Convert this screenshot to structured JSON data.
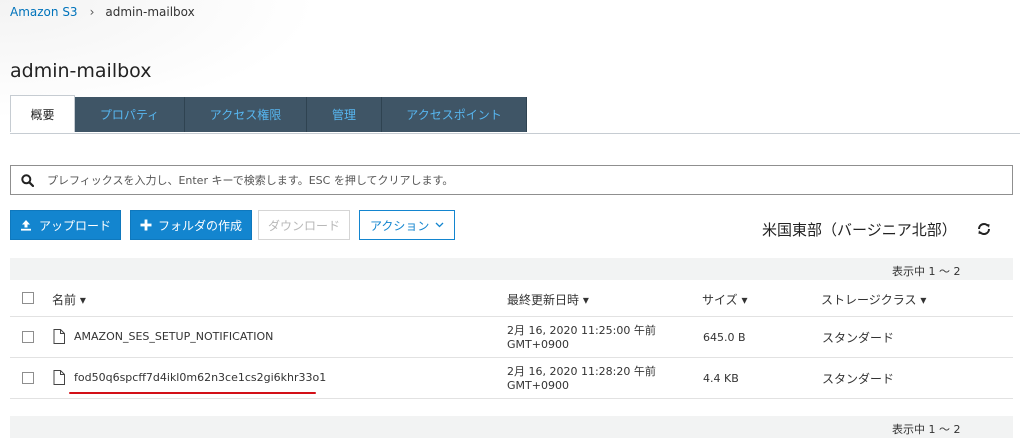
{
  "breadcrumb": {
    "root": "Amazon S3",
    "separator": "›",
    "current": "admin-mailbox"
  },
  "bucket_title": "admin-mailbox",
  "tabs": [
    {
      "label": "概要",
      "active": true
    },
    {
      "label": "プロパティ",
      "active": false
    },
    {
      "label": "アクセス権限",
      "active": false
    },
    {
      "label": "管理",
      "active": false
    },
    {
      "label": "アクセスポイント",
      "active": false
    }
  ],
  "search": {
    "placeholder": "プレフィックスを入力し、Enter キーで検索します。ESC を押してクリアします。"
  },
  "toolbar": {
    "upload": "アップロード",
    "create_folder": "フォルダの作成",
    "download": "ダウンロード",
    "actions": "アクション"
  },
  "region": "米国東部（バージニア北部）",
  "pagination": {
    "top": "表示中 1 ～ 2",
    "bottom": "表示中 1 ～ 2"
  },
  "table": {
    "columns": {
      "name": "名前",
      "modified": "最終更新日時",
      "size": "サイズ",
      "storage": "ストレージクラス"
    },
    "rows": [
      {
        "name": "AMAZON_SES_SETUP_NOTIFICATION",
        "modified_line1": "2月 16, 2020 11:25:00 午前",
        "modified_line2": "GMT+0900",
        "size": "645.0 B",
        "storage": "スタンダード"
      },
      {
        "name": "fod50q6spcff7d4ikl0m62n3ce1cs2gi6khr33o1",
        "modified_line1": "2月 16, 2020 11:28:20 午前",
        "modified_line2": "GMT+0900",
        "size": "4.4 KB",
        "storage": "スタンダード"
      }
    ]
  },
  "colors": {
    "accent": "#1385cf",
    "tab_bg": "#3f5566",
    "tab_text": "#57b6f0",
    "highlight": "#d30f17"
  },
  "icons": [
    "search-icon",
    "upload-icon",
    "plus-icon",
    "chevron-down-icon",
    "refresh-icon",
    "file-icon",
    "sort-caret-icon"
  ]
}
